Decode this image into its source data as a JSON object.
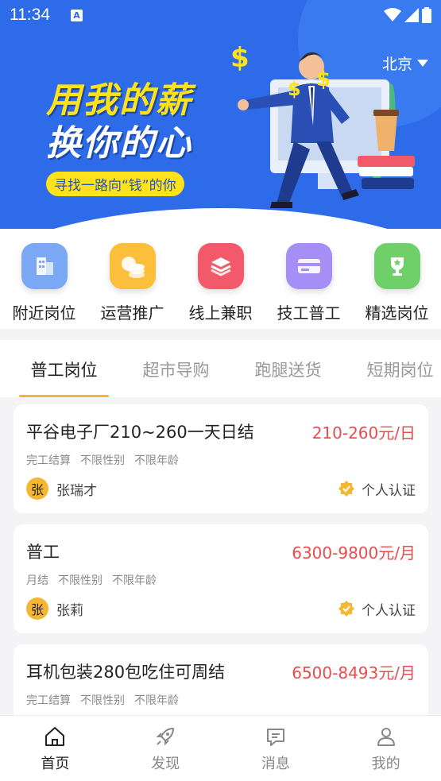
{
  "status_bar": {
    "time": "11:34",
    "notification": "A"
  },
  "banner": {
    "city": "北京",
    "slogan_line1": "用我的薪",
    "slogan_line2": "换你的心",
    "slogan_sub": "寻找一路向“钱”的你"
  },
  "categories": [
    {
      "label": "附近岗位",
      "icon": "building-icon",
      "color": "#7aa8f5"
    },
    {
      "label": "运营推广",
      "icon": "coins-icon",
      "color": "#fbbf3c"
    },
    {
      "label": "线上兼职",
      "icon": "layers-icon",
      "color": "#f25a6b"
    },
    {
      "label": "技工普工",
      "icon": "card-icon",
      "color": "#a58ef5"
    },
    {
      "label": "精选岗位",
      "icon": "trophy-icon",
      "color": "#6fd06a"
    }
  ],
  "tabs": [
    {
      "label": "普工岗位",
      "active": true
    },
    {
      "label": "超市导购",
      "active": false
    },
    {
      "label": "跑腿送货",
      "active": false
    },
    {
      "label": "短期岗位",
      "active": false
    }
  ],
  "jobs": [
    {
      "title": "平谷电子厂210~260一天日结",
      "salary": "210-260元/日",
      "tags": [
        "完工结算",
        "不限性别",
        "不限年龄"
      ],
      "avatar": "张",
      "poster": "张瑞才",
      "verify": "个人认证"
    },
    {
      "title": "普工",
      "salary": "6300-9800元/月",
      "tags": [
        "月结",
        "不限性别",
        "不限年龄"
      ],
      "avatar": "张",
      "poster": "张莉",
      "verify": "个人认证"
    },
    {
      "title": "耳机包装280包吃住可周结",
      "salary": "6500-8493元/月",
      "tags": [
        "完工结算",
        "不限性别",
        "不限年龄"
      ],
      "avatar": "",
      "poster": "",
      "verify": ""
    }
  ],
  "nav": [
    {
      "label": "首页",
      "icon": "home-icon",
      "active": true
    },
    {
      "label": "发现",
      "icon": "rocket-icon",
      "active": false
    },
    {
      "label": "消息",
      "icon": "message-icon",
      "active": false
    },
    {
      "label": "我的",
      "icon": "user-icon",
      "active": false
    }
  ],
  "colors": {
    "accent": "#f5b731",
    "banner": "#2d6be8",
    "salary": "#e84d4d"
  }
}
